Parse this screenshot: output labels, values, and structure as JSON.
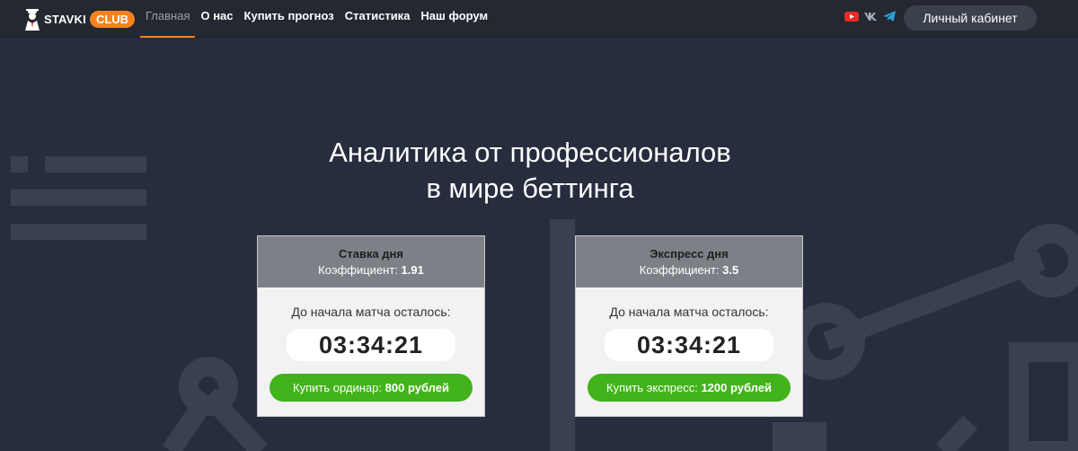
{
  "header": {
    "logo_text": "STAVKI",
    "logo_badge": "CLUB",
    "nav": [
      {
        "label": "Главная",
        "active": true
      },
      {
        "label": "О нас"
      },
      {
        "label": "Купить прогноз"
      },
      {
        "label": "Статистика"
      },
      {
        "label": "Наш форум"
      }
    ],
    "social_icons": [
      "youtube-icon",
      "vk-icon",
      "telegram-icon"
    ],
    "cabinet_label": "Личный кабинет"
  },
  "hero": {
    "title_line1": "Аналитика от профессионалов",
    "title_line2": "в мире беттинга"
  },
  "cards": [
    {
      "title": "Ставка дня",
      "coef_label": "Коэффициент:",
      "coef_value": "1.91",
      "countdown_label": "До начала матча осталось:",
      "timer": "03:34:21",
      "button_label": "Купить ординар:",
      "button_price": "800 рублей"
    },
    {
      "title": "Экспресс дня",
      "coef_label": "Коэффициент:",
      "coef_value": "3.5",
      "countdown_label": "До начала матча осталось:",
      "timer": "03:34:21",
      "button_label": "Купить экспресс:",
      "button_price": "1200 рублей"
    }
  ],
  "colors": {
    "accent": "#f5821f",
    "buy_button": "#42b31a",
    "background": "#262d3d"
  }
}
